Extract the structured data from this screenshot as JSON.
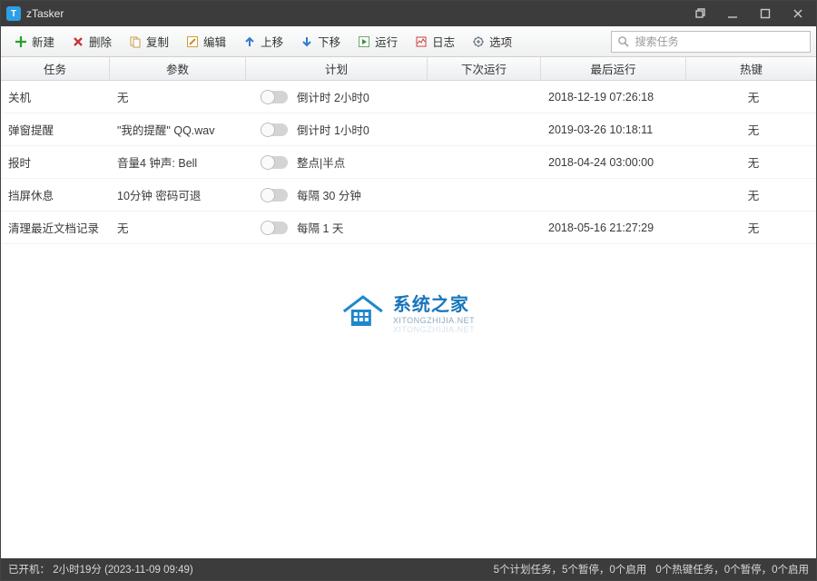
{
  "titlebar": {
    "app_name": "zTasker"
  },
  "toolbar": {
    "new": "新建",
    "delete": "删除",
    "copy": "复制",
    "edit": "编辑",
    "move_up": "上移",
    "move_down": "下移",
    "run": "运行",
    "log": "日志",
    "options": "选项",
    "search_placeholder": "搜索任务"
  },
  "columns": {
    "task": "任务",
    "param": "参数",
    "plan": "计划",
    "next_run": "下次运行",
    "last_run": "最后运行",
    "hotkey": "热键"
  },
  "rows": [
    {
      "task": "关机",
      "param": "无",
      "plan": "倒计时 2小时0",
      "next": "",
      "last": "2018-12-19 07:26:18",
      "hotkey": "无"
    },
    {
      "task": "弹窗提醒",
      "param": "\"我的提醒\" QQ.wav",
      "plan": "倒计时 1小时0",
      "next": "",
      "last": "2019-03-26 10:18:11",
      "hotkey": "无"
    },
    {
      "task": "报时",
      "param": "音量4 钟声: Bell",
      "plan": "整点|半点",
      "next": "",
      "last": "2018-04-24 03:00:00",
      "hotkey": "无"
    },
    {
      "task": "挡屏休息",
      "param": "10分钟 密码可退",
      "plan": "每隔 30 分钟",
      "next": "",
      "last": "",
      "hotkey": "无"
    },
    {
      "task": "清理最近文档记录",
      "param": "无",
      "plan": "每隔 1 天",
      "next": "",
      "last": "2018-05-16 21:27:29",
      "hotkey": "无"
    }
  ],
  "statusbar": {
    "uptime_label": "已开机：",
    "uptime": "2小时19分 (2023-11-09 09:49)",
    "summary1": "5个计划任务，5个暂停，0个启用",
    "summary2": "0个热键任务，0个暂停，0个启用"
  },
  "watermark": {
    "title": "系统之家",
    "url": "XITONGZHIJIA.NET",
    "shadow": "XITONGZHIJIA.NET"
  }
}
